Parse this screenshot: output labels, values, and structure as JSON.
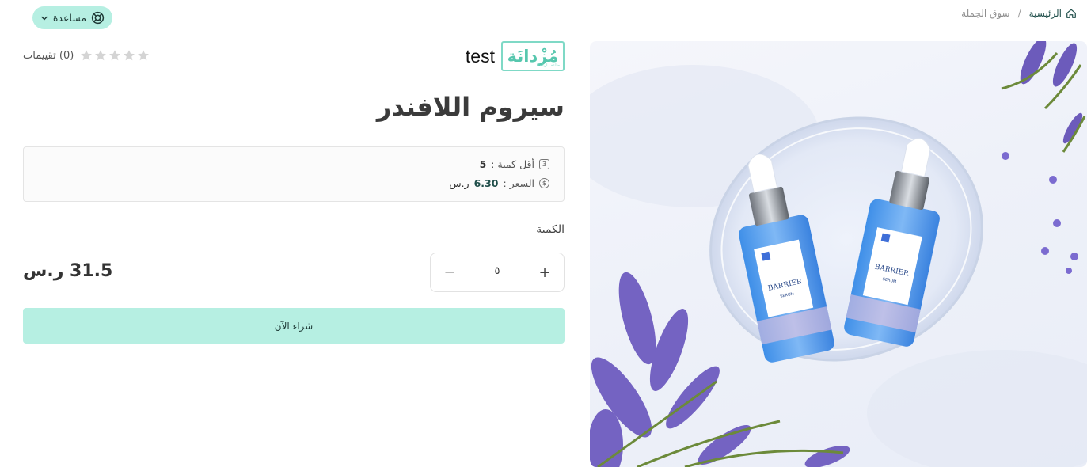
{
  "breadcrumb": {
    "home_label": "الرئيسية",
    "separator": "/",
    "current_label": "سوق الجملة",
    "home_icon": "home-icon"
  },
  "help": {
    "label": "مساعدة",
    "icon": "lifebuoy-icon",
    "chevron": "chevron-down-icon"
  },
  "store": {
    "name": "test",
    "logo_text": "مُزْدانَة",
    "logo_subtext": "ضاعف أرباحك",
    "logo_color": "#57c7ae"
  },
  "rating": {
    "text": "(0) تقييمات",
    "stars_filled": 0,
    "stars_total": 5
  },
  "product": {
    "title": "سيروم اللافندر",
    "min_qty_label": "أقل كمية :",
    "min_qty_value": "5",
    "price_label": "السعر :",
    "price_value": "6.30",
    "currency": "ر.س",
    "image_alt": "serum-bottles-product-image"
  },
  "quantity": {
    "label": "الكمية",
    "value": "٥",
    "plus": "+",
    "minus": "−"
  },
  "total": {
    "text": "31.5 ر.س"
  },
  "buy_button": {
    "label": "شراء الآن"
  },
  "colors": {
    "accent": "#b6efe2",
    "accent_dark": "#1f4e4a"
  }
}
